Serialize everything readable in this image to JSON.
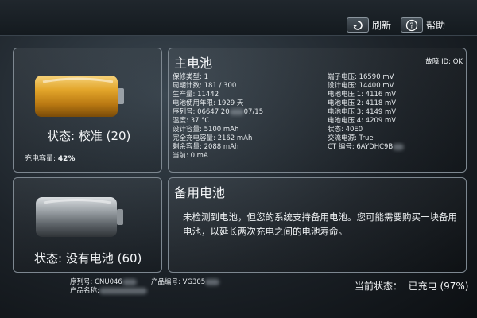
{
  "toolbar": {
    "refresh_label": "刷新",
    "help_label": "帮助"
  },
  "main_battery": {
    "status": "状态: 校准 (20)",
    "charge_capacity_label": "充电容量: ",
    "charge_capacity_value": "42%",
    "charge_fraction": 0.42,
    "title": "主电池",
    "fault_id": "故障 ID: OK",
    "left_info": [
      "保修类型: 1",
      "周期计数: 181 / 300",
      "生产量: 11442",
      "电池使用年限: 1929 天",
      "序列号: 06647 20",
      "07/15",
      "温度: 37 °C",
      "设计容量: 5100 mAh",
      "完全充电容量: 2162 mAh",
      "剩余容量: 2088 mAh",
      "当前: 0 mA"
    ],
    "right_info": [
      "端子电压: 16590 mV",
      "设计电压: 14400 mV",
      "电池电压 1: 4116 mV",
      "电池电压 2: 4118 mV",
      "电池电压 3: 4149 mV",
      "电池电压 4: 4209 mV",
      "状态: 40E0",
      "交流电源: True",
      "CT 编号: 6AYDHC9B"
    ]
  },
  "backup_battery": {
    "status": "状态: 没有电池 (60)",
    "title": "备用电池",
    "message": "未检测到电池，但您的系统支持备用电池。您可能需要购买一块备用电池，以延长两次充电之间的电池寿命。"
  },
  "footer": {
    "serial_label": "序列号: CNU046",
    "product_number_label": "产品编号: VG305",
    "product_name_label": "产品名称:",
    "current_status": "当前状态：  已充电 (97%)"
  },
  "colors": {
    "battery_gold": "#e0a020",
    "battery_gray": "#8a9096"
  }
}
